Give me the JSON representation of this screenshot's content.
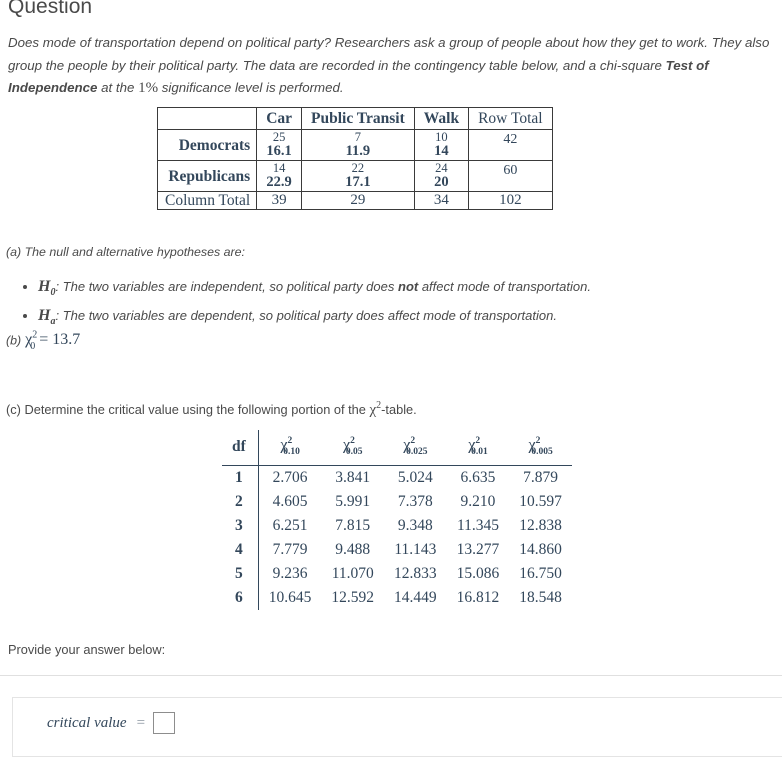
{
  "heading": "Question",
  "intro": {
    "line1": "Does mode of transportation depend on political party? Researchers ask a group of people about how they get to work.",
    "line2": "They also group the people by their political party. The data are recorded in the contingency table below, and a chi-square",
    "bold_phrase": "Test of Independence",
    "after_bold": " at the ",
    "significance": "1%",
    "line3_tail": " significance level is performed."
  },
  "contingency_table": {
    "corner": "",
    "columns": [
      "Car",
      "Public Transit",
      "Walk",
      "Row Total"
    ],
    "rows": [
      {
        "label": "Democrats",
        "cells": [
          {
            "observed": "25",
            "expected": "16.1"
          },
          {
            "observed": "7",
            "expected": "11.9"
          },
          {
            "observed": "10",
            "expected": "14"
          }
        ],
        "row_total": "42"
      },
      {
        "label": "Republicans",
        "cells": [
          {
            "observed": "14",
            "expected": "22.9"
          },
          {
            "observed": "22",
            "expected": "17.1"
          },
          {
            "observed": "24",
            "expected": "20"
          }
        ],
        "row_total": "60"
      }
    ],
    "total_row": {
      "label": "Column Total",
      "values": [
        "39",
        "29",
        "34"
      ],
      "grand_total": "102"
    }
  },
  "part_a": {
    "prompt": "(a)  The null and alternative hypotheses are:",
    "null_symbol": "H",
    "null_sub": "0",
    "null_text_pre": ": The two variables are independent, so political party does ",
    "null_bold": "not",
    "null_text_post": " affect mode of transportation.",
    "alt_symbol": "H",
    "alt_sub": "a",
    "alt_text": ": The two variables are dependent, so political party does affect mode of transportation."
  },
  "part_b": {
    "prompt": "(b)",
    "chi_symbol": "χ",
    "chi_sup": "2",
    "chi_sub": "0",
    "equals": " = ",
    "value": "13.7"
  },
  "part_c": {
    "prompt_pre": "(c)  Determine the critical value using the following portion of the ",
    "chi_symbol": "χ",
    "chi_sup": "2",
    "prompt_post": "-table."
  },
  "chi_table": {
    "df_header": "df",
    "columns": [
      {
        "symbol": "χ",
        "sup": "2",
        "sub": "0.10"
      },
      {
        "symbol": "χ",
        "sup": "2",
        "sub": "0.05"
      },
      {
        "symbol": "χ",
        "sup": "2",
        "sub": "0.025"
      },
      {
        "symbol": "χ",
        "sup": "2",
        "sub": "0.01"
      },
      {
        "symbol": "χ",
        "sup": "2",
        "sub": "0.005"
      }
    ],
    "rows": [
      {
        "df": "1",
        "values": [
          "2.706",
          "3.841",
          "5.024",
          "6.635",
          "7.879"
        ]
      },
      {
        "df": "2",
        "values": [
          "4.605",
          "5.991",
          "7.378",
          "9.210",
          "10.597"
        ]
      },
      {
        "df": "3",
        "values": [
          "6.251",
          "7.815",
          "9.348",
          "11.345",
          "12.838"
        ]
      },
      {
        "df": "4",
        "values": [
          "7.779",
          "9.488",
          "11.143",
          "13.277",
          "14.860"
        ]
      },
      {
        "df": "5",
        "values": [
          "9.236",
          "11.070",
          "12.833",
          "15.086",
          "16.750"
        ]
      },
      {
        "df": "6",
        "values": [
          "10.645",
          "12.592",
          "14.449",
          "16.812",
          "18.548"
        ]
      }
    ]
  },
  "answer": {
    "provide_label": "Provide your answer below:",
    "critical_value_label": "critical value",
    "equals": "=",
    "input_value": ""
  }
}
